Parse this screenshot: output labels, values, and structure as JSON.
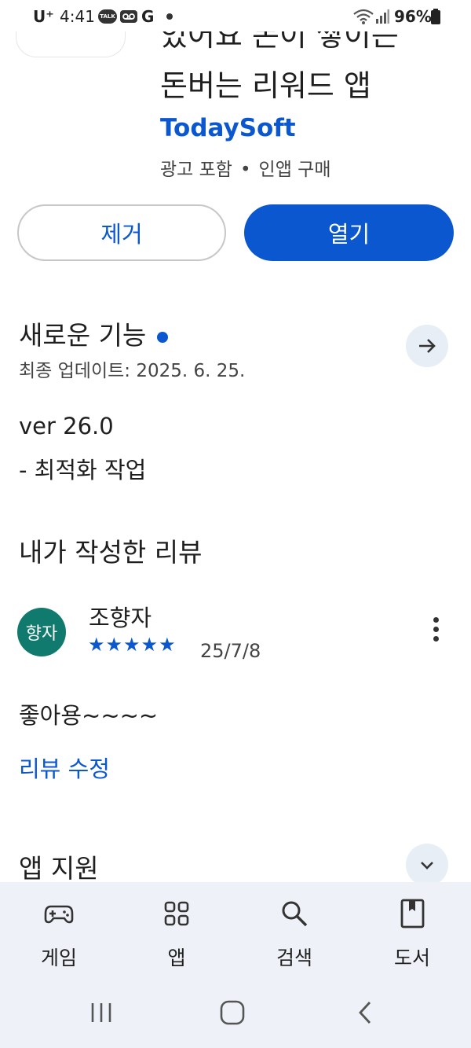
{
  "status_bar": {
    "carrier": "U⁺",
    "time": "4:41",
    "notif_badge": "TALK",
    "g_letter": "G",
    "battery": "96%"
  },
  "header": {
    "title_line1": "있어요 돈이 쌓이는",
    "title_line2": "돈버는 리워드 앱",
    "developer": "TodaySoft",
    "meta_ads": "광고 포함",
    "meta_iap": "인앱 구매"
  },
  "actions": {
    "remove_label": "제거",
    "open_label": "열기"
  },
  "whats_new": {
    "title": "새로운 기능",
    "updated": "최종 업데이트: 2025. 6. 25.",
    "version": "ver 26.0",
    "note": "- 최적화 작업"
  },
  "my_review": {
    "title": "내가 작성한 리뷰",
    "avatar_text": "향자",
    "reviewer": "조향자",
    "stars": "★★★★★",
    "rating": 5,
    "date": "25/7/8",
    "text": "좋아용~~~~",
    "edit_label": "리뷰 수정"
  },
  "app_support": {
    "title": "앱 지원"
  },
  "bottom_nav": {
    "items": [
      {
        "label": "게임",
        "icon": "gamepad-icon"
      },
      {
        "label": "앱",
        "icon": "apps-grid-icon"
      },
      {
        "label": "검색",
        "icon": "search-icon"
      },
      {
        "label": "도서",
        "icon": "book-icon"
      }
    ]
  },
  "colors": {
    "accent": "#0b57d0",
    "avatar_bg": "#117a6e",
    "nav_bg": "#eef2f8"
  }
}
